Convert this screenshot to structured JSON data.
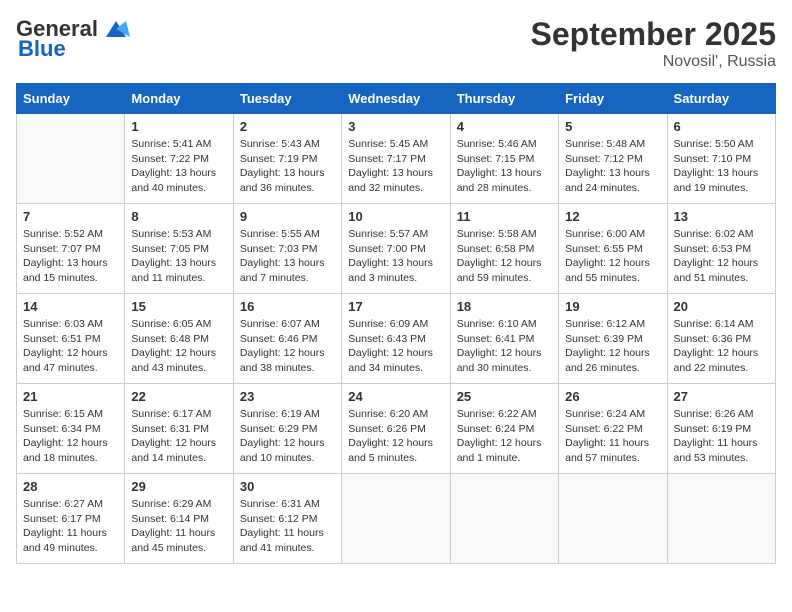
{
  "header": {
    "logo_line1": "General",
    "logo_line2": "Blue",
    "month": "September 2025",
    "location": "Novosil', Russia"
  },
  "days_of_week": [
    "Sunday",
    "Monday",
    "Tuesday",
    "Wednesday",
    "Thursday",
    "Friday",
    "Saturday"
  ],
  "weeks": [
    [
      {
        "day": "",
        "detail": ""
      },
      {
        "day": "1",
        "detail": "Sunrise: 5:41 AM\nSunset: 7:22 PM\nDaylight: 13 hours\nand 40 minutes."
      },
      {
        "day": "2",
        "detail": "Sunrise: 5:43 AM\nSunset: 7:19 PM\nDaylight: 13 hours\nand 36 minutes."
      },
      {
        "day": "3",
        "detail": "Sunrise: 5:45 AM\nSunset: 7:17 PM\nDaylight: 13 hours\nand 32 minutes."
      },
      {
        "day": "4",
        "detail": "Sunrise: 5:46 AM\nSunset: 7:15 PM\nDaylight: 13 hours\nand 28 minutes."
      },
      {
        "day": "5",
        "detail": "Sunrise: 5:48 AM\nSunset: 7:12 PM\nDaylight: 13 hours\nand 24 minutes."
      },
      {
        "day": "6",
        "detail": "Sunrise: 5:50 AM\nSunset: 7:10 PM\nDaylight: 13 hours\nand 19 minutes."
      }
    ],
    [
      {
        "day": "7",
        "detail": "Sunrise: 5:52 AM\nSunset: 7:07 PM\nDaylight: 13 hours\nand 15 minutes."
      },
      {
        "day": "8",
        "detail": "Sunrise: 5:53 AM\nSunset: 7:05 PM\nDaylight: 13 hours\nand 11 minutes."
      },
      {
        "day": "9",
        "detail": "Sunrise: 5:55 AM\nSunset: 7:03 PM\nDaylight: 13 hours\nand 7 minutes."
      },
      {
        "day": "10",
        "detail": "Sunrise: 5:57 AM\nSunset: 7:00 PM\nDaylight: 13 hours\nand 3 minutes."
      },
      {
        "day": "11",
        "detail": "Sunrise: 5:58 AM\nSunset: 6:58 PM\nDaylight: 12 hours\nand 59 minutes."
      },
      {
        "day": "12",
        "detail": "Sunrise: 6:00 AM\nSunset: 6:55 PM\nDaylight: 12 hours\nand 55 minutes."
      },
      {
        "day": "13",
        "detail": "Sunrise: 6:02 AM\nSunset: 6:53 PM\nDaylight: 12 hours\nand 51 minutes."
      }
    ],
    [
      {
        "day": "14",
        "detail": "Sunrise: 6:03 AM\nSunset: 6:51 PM\nDaylight: 12 hours\nand 47 minutes."
      },
      {
        "day": "15",
        "detail": "Sunrise: 6:05 AM\nSunset: 6:48 PM\nDaylight: 12 hours\nand 43 minutes."
      },
      {
        "day": "16",
        "detail": "Sunrise: 6:07 AM\nSunset: 6:46 PM\nDaylight: 12 hours\nand 38 minutes."
      },
      {
        "day": "17",
        "detail": "Sunrise: 6:09 AM\nSunset: 6:43 PM\nDaylight: 12 hours\nand 34 minutes."
      },
      {
        "day": "18",
        "detail": "Sunrise: 6:10 AM\nSunset: 6:41 PM\nDaylight: 12 hours\nand 30 minutes."
      },
      {
        "day": "19",
        "detail": "Sunrise: 6:12 AM\nSunset: 6:39 PM\nDaylight: 12 hours\nand 26 minutes."
      },
      {
        "day": "20",
        "detail": "Sunrise: 6:14 AM\nSunset: 6:36 PM\nDaylight: 12 hours\nand 22 minutes."
      }
    ],
    [
      {
        "day": "21",
        "detail": "Sunrise: 6:15 AM\nSunset: 6:34 PM\nDaylight: 12 hours\nand 18 minutes."
      },
      {
        "day": "22",
        "detail": "Sunrise: 6:17 AM\nSunset: 6:31 PM\nDaylight: 12 hours\nand 14 minutes."
      },
      {
        "day": "23",
        "detail": "Sunrise: 6:19 AM\nSunset: 6:29 PM\nDaylight: 12 hours\nand 10 minutes."
      },
      {
        "day": "24",
        "detail": "Sunrise: 6:20 AM\nSunset: 6:26 PM\nDaylight: 12 hours\nand 5 minutes."
      },
      {
        "day": "25",
        "detail": "Sunrise: 6:22 AM\nSunset: 6:24 PM\nDaylight: 12 hours\nand 1 minute."
      },
      {
        "day": "26",
        "detail": "Sunrise: 6:24 AM\nSunset: 6:22 PM\nDaylight: 11 hours\nand 57 minutes."
      },
      {
        "day": "27",
        "detail": "Sunrise: 6:26 AM\nSunset: 6:19 PM\nDaylight: 11 hours\nand 53 minutes."
      }
    ],
    [
      {
        "day": "28",
        "detail": "Sunrise: 6:27 AM\nSunset: 6:17 PM\nDaylight: 11 hours\nand 49 minutes."
      },
      {
        "day": "29",
        "detail": "Sunrise: 6:29 AM\nSunset: 6:14 PM\nDaylight: 11 hours\nand 45 minutes."
      },
      {
        "day": "30",
        "detail": "Sunrise: 6:31 AM\nSunset: 6:12 PM\nDaylight: 11 hours\nand 41 minutes."
      },
      {
        "day": "",
        "detail": ""
      },
      {
        "day": "",
        "detail": ""
      },
      {
        "day": "",
        "detail": ""
      },
      {
        "day": "",
        "detail": ""
      }
    ]
  ]
}
